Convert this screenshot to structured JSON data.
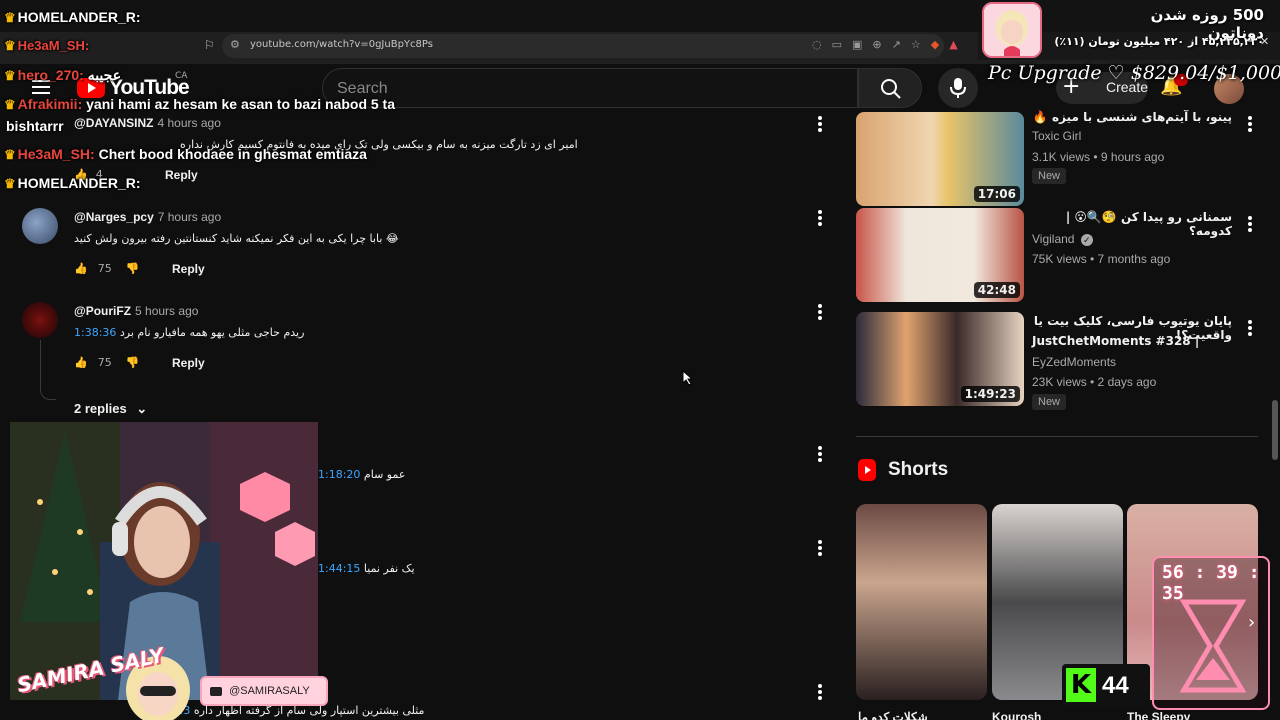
{
  "browser": {
    "url": "youtube.com/watch?v=0gJuBpYc8Ps"
  },
  "header": {
    "logo_text": "YouTube",
    "country": "CA",
    "search_placeholder": "Search",
    "create_label": "Create"
  },
  "comments": [
    {
      "author": "@DAYANSINZ",
      "time": "4 hours ago",
      "text": "امیر ای زد تارگت میزنه به سام و بیکسی ولی تک رای میده به فانتوم کسیم کارش نداره",
      "likes": "4",
      "reply_label": "Reply"
    },
    {
      "author": "@Narges_pcy",
      "time": "7 hours ago",
      "text": "بابا چرا یکی به این فکر نمیکنه شاید کنستانتین رفته بیرون ولش کنید 😂",
      "likes": "75",
      "reply_label": "Reply"
    },
    {
      "author": "@PouriFZ",
      "time": "5 hours ago",
      "timestamp": "1:38:36",
      "text": "ریدم حاجی مثلی یهو همه مافیارو نام برد",
      "likes": "75",
      "reply_label": "Reply"
    },
    {
      "timestamp": "1:18:20",
      "text": "عمو سام"
    },
    {
      "timestamp": "1:44:15",
      "text": "یک نفر نمیا"
    },
    {
      "timestamp": "1:54:23",
      "text": "مثلی بیشترین استپار ولی سام از گرفته اظهار داره"
    }
  ],
  "replies_toggle": "2 replies",
  "recommendations": [
    {
      "title": "پینو، با آیتم‌های شنسی با میزه 🔥",
      "channel": "Toxic Girl",
      "meta": "3.1K views • 9 hours ago",
      "duration": "17:06",
      "badge": "New"
    },
    {
      "title": "سمنانی رو پیدا کن 🧐🔍😮 | کدومه؟",
      "channel": "Vigiland",
      "meta": "75K views • 7 months ago",
      "duration": "42:48",
      "badge": ""
    },
    {
      "title": "پایان یوتیوب فارسی، کلیک بیت یا واقعیت؟!",
      "title2": "JustChetMoments #328 |",
      "channel": "EyZedMoments",
      "meta": "23K views • 2 days ago",
      "duration": "1:49:23",
      "badge": "New"
    }
  ],
  "shorts": {
    "heading": "Shorts",
    "items": [
      {
        "title": "شکلات کدو ما"
      },
      {
        "title": "Kourosh"
      },
      {
        "title": "The Sleepy"
      }
    ]
  },
  "stream_overlay": {
    "chat": [
      {
        "user": "HOMELANDER_R:",
        "msg": "",
        "color": "#ffffff"
      },
      {
        "user": "He3aM_SH:",
        "msg": "",
        "color": "#e8453c"
      },
      {
        "user": "hero_270:",
        "msg": "عجیبه",
        "color": "#e8453c"
      },
      {
        "user": "Afrakimii:",
        "msg": "yani hami az hesam ke asan to bazi nabod 5 ta",
        "color": "#e8453c"
      },
      {
        "user": "",
        "msg": "bishtarrr",
        "color": "#ffffff"
      },
      {
        "user": "He3aM_SH:",
        "msg": "Chert bood khodaee in ghesmat emtiaza",
        "color": "#e8453c"
      },
      {
        "user": "HOMELANDER_R:",
        "msg": "",
        "color": "#ffffff"
      }
    ],
    "donation_title": "500 روزه شدن دوناتون",
    "donation_sub": "۴۵,۲۳۵,۲۳۰ از ۴۲۰ میلیون تومان (۱۱٪)",
    "upgrade_goal": "Pc Upgrade ♡ $829.04/$1,000",
    "brand_name": "SAMIRA SALY",
    "handle": "@SAMIRASALY",
    "timer": "56 : 39 : 35",
    "kick_count": "44"
  }
}
